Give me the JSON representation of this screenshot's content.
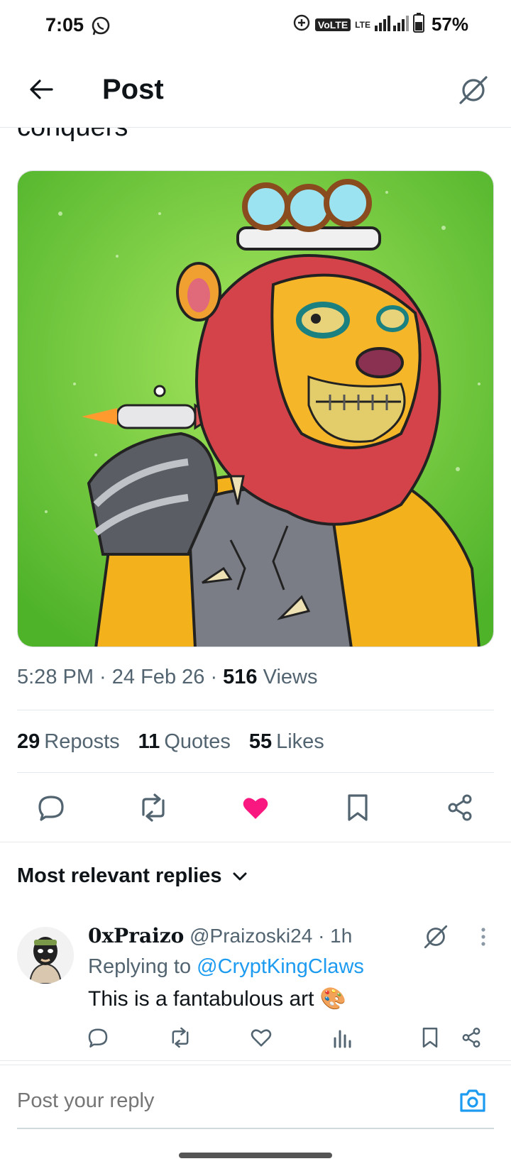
{
  "status_bar": {
    "time": "7:05",
    "volte": "VoLTE",
    "lte": "LTE",
    "battery": "57%"
  },
  "header": {
    "title": "Post"
  },
  "tweet": {
    "text_fragment": "conquers",
    "time": "5:28 PM",
    "date": "24 Feb 26",
    "views_count": "516",
    "views_label": "Views",
    "reposts_count": "29",
    "reposts_label": "Reposts",
    "quotes_count": "11",
    "quotes_label": "Quotes",
    "likes_count": "55",
    "likes_label": "Likes",
    "liked": true,
    "like_color": "#f91880"
  },
  "replies": {
    "header": "Most relevant replies",
    "items": [
      {
        "name": "0xPraizo",
        "handle": "@Praizoski24",
        "time": "1h",
        "replying_prefix": "Replying to",
        "replying_to": "@CryptKingClaws",
        "text": "This is a fantabulous art 🎨"
      }
    ]
  },
  "composer": {
    "placeholder": "Post your reply"
  },
  "colors": {
    "accent": "#1d9bf0",
    "secondary_text": "#536471"
  }
}
